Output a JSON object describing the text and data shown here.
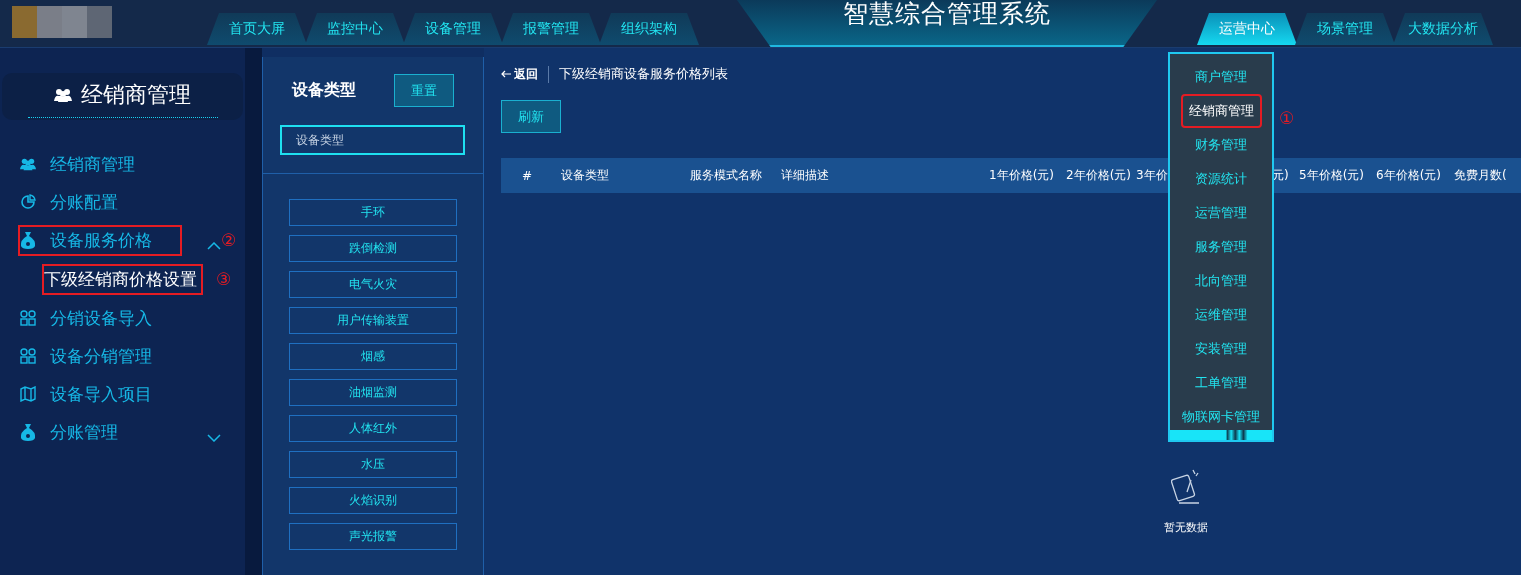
{
  "header": {
    "title": "智慧综合管理系统",
    "left_tabs": [
      {
        "label": "首页大屏",
        "selected": false
      },
      {
        "label": "监控中心",
        "selected": false
      },
      {
        "label": "设备管理",
        "selected": false
      },
      {
        "label": "报警管理",
        "selected": false
      },
      {
        "label": "组织架构",
        "selected": false
      }
    ],
    "right_tabs": [
      {
        "label": "运营中心",
        "selected": true
      },
      {
        "label": "场景管理",
        "selected": false
      },
      {
        "label": "大数据分析",
        "selected": false
      }
    ]
  },
  "sidebar": {
    "title": "经销商管理",
    "items": [
      {
        "label": "经销商管理",
        "selected": false
      },
      {
        "label": "分账配置",
        "selected": false
      },
      {
        "label": "设备服务价格",
        "selected": false,
        "expanded": true,
        "annotation": "②",
        "children": [
          {
            "label": "下级经销商价格设置",
            "selected": true,
            "annotation": "③"
          }
        ]
      },
      {
        "label": "分销设备导入",
        "selected": false
      },
      {
        "label": "设备分销管理",
        "selected": false
      },
      {
        "label": "设备导入项目",
        "selected": false
      },
      {
        "label": "分账管理",
        "selected": false,
        "expanded": false
      }
    ]
  },
  "type_panel": {
    "title": "设备类型",
    "reset_button": "重置",
    "search": {
      "placeholder": "设备类型"
    },
    "types": [
      "手环",
      "跌倒检测",
      "电气火灾",
      "用户传输装置",
      "烟感",
      "油烟监测",
      "人体红外",
      "水压",
      "火焰识别",
      "声光报警"
    ]
  },
  "main": {
    "back": "返回",
    "page_title": "下级经销商设备服务价格列表",
    "refresh_button": "刷新",
    "table": {
      "columns": [
        "#",
        "设备类型",
        "服务模式名称",
        "详细描述",
        "1年价格(元)",
        "2年价格(元)",
        "3年价",
        "元)",
        "5年价格(元)",
        "6年价格(元)",
        "免费月数("
      ]
    },
    "empty_text": "暂无数据"
  },
  "ops_menu": {
    "items": [
      {
        "label": "商户管理",
        "selected": false
      },
      {
        "label": "经销商管理",
        "selected": true,
        "annotation": "①"
      },
      {
        "label": "财务管理",
        "selected": false
      },
      {
        "label": "资源统计",
        "selected": false
      },
      {
        "label": "运营管理",
        "selected": false
      },
      {
        "label": "服务管理",
        "selected": false
      },
      {
        "label": "北向管理",
        "selected": false
      },
      {
        "label": "运维管理",
        "selected": false
      },
      {
        "label": "安装管理",
        "selected": false
      },
      {
        "label": "工单管理",
        "selected": false
      },
      {
        "label": "物联网卡管理",
        "selected": false
      }
    ]
  }
}
